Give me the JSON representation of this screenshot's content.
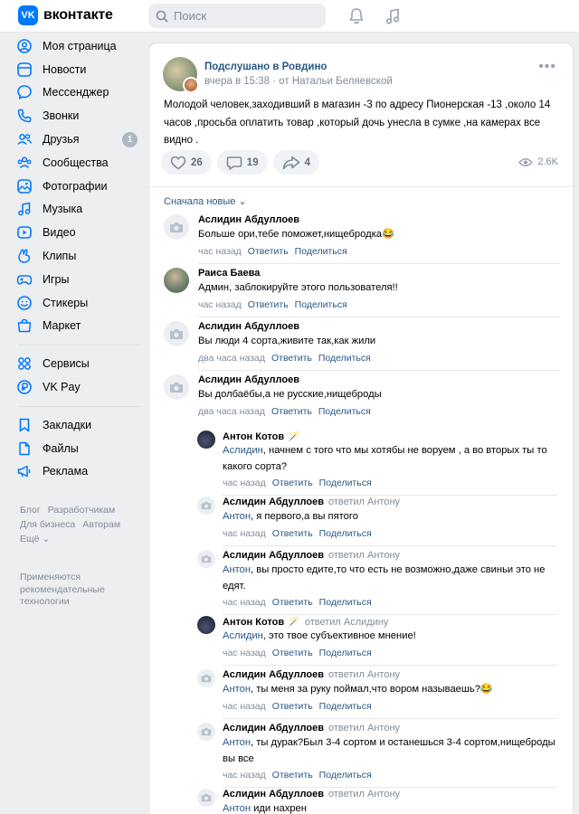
{
  "header": {
    "logo_letter": "VK",
    "logo_text": "вконтакте",
    "search_placeholder": "Поиск",
    "icons": [
      "bell-icon",
      "music-icon"
    ]
  },
  "sidebar": {
    "items": [
      {
        "label": "Моя страница",
        "icon": "profile-icon"
      },
      {
        "label": "Новости",
        "icon": "news-icon"
      },
      {
        "label": "Мессенджер",
        "icon": "messenger-icon"
      },
      {
        "label": "Звонки",
        "icon": "phone-icon"
      },
      {
        "label": "Друзья",
        "icon": "friends-icon",
        "badge": "1"
      },
      {
        "label": "Сообщества",
        "icon": "communities-icon"
      },
      {
        "label": "Фотографии",
        "icon": "photos-icon"
      },
      {
        "label": "Музыка",
        "icon": "music-icon"
      },
      {
        "label": "Видео",
        "icon": "video-icon"
      },
      {
        "label": "Клипы",
        "icon": "clips-icon"
      },
      {
        "label": "Игры",
        "icon": "games-icon"
      },
      {
        "label": "Стикеры",
        "icon": "stickers-icon"
      },
      {
        "label": "Маркет",
        "icon": "market-icon"
      }
    ],
    "items2": [
      {
        "label": "Сервисы",
        "icon": "services-icon"
      },
      {
        "label": "VK Pay",
        "icon": "vkpay-icon"
      }
    ],
    "items3": [
      {
        "label": "Закладки",
        "icon": "bookmarks-icon"
      },
      {
        "label": "Файлы",
        "icon": "files-icon"
      },
      {
        "label": "Реклама",
        "icon": "ads-icon"
      }
    ],
    "footer": {
      "blog": "Блог",
      "developers": "Разработчикам",
      "business": "Для бизнеса",
      "authors": "Авторам",
      "more": "Ещё ⌄",
      "note": "Применяются рекомендательные технологии"
    }
  },
  "post": {
    "author": "Подслушано в Ровдино",
    "meta": "вчера в 15:38 · от Натальи Беляевской",
    "text": "Молодой человек,заходивший в магазин -3 по адресу Пионерская -13 ,около 14 часов ,просьба оплатить товар ,который дочь унесла в сумке ,на камерах все видно .",
    "likes": "26",
    "comments": "19",
    "shares": "4",
    "views": "2.6K",
    "sort_label": "Сначала новые ⌄"
  },
  "comment_labels": {
    "reply": "Ответить",
    "share": "Поделиться"
  },
  "comments": [
    {
      "name": "Аслидин Абдуллоев",
      "text": "Больше ори,тебе поможет,нищебродка😂",
      "time": "час назад"
    },
    {
      "name": "Раиса Баева",
      "text": "Админ, заблокируйте этого пользователя!!",
      "time": "час назад"
    },
    {
      "name": "Аслидин Абдуллоев",
      "text": "Вы люди 4 сорта,живите так,как жили",
      "time": "два часа назад"
    },
    {
      "name": "Аслидин Абдуллоев",
      "text": "Вы долбаёбы,а не русские,нищеброды",
      "time": "два часа назад"
    }
  ],
  "replies": [
    {
      "name": "Антон Котов",
      "wand": "🪄",
      "reply_to": "",
      "addr": "Аслидин",
      "text": ", начнем с того что мы хотябы не воруем , а во вторых ты то какого сорта?",
      "time": "час назад"
    },
    {
      "name": "Аслидин Абдуллоев",
      "wand": "",
      "reply_to": "ответил Антону",
      "addr": "Антон",
      "text": ", я первого,а вы пятого",
      "time": "час назад"
    },
    {
      "name": "Аслидин Абдуллоев",
      "wand": "",
      "reply_to": "ответил Антону",
      "addr": "Антон",
      "text": ", вы просто едите,то что есть не возможно,даже свиньи это не едят.",
      "time": "час назад"
    },
    {
      "name": "Антон Котов",
      "wand": "🪄",
      "reply_to": "ответил Аслидину",
      "addr": "Аслидин",
      "text": ", это твое субъективное мнение!",
      "time": "час назад"
    },
    {
      "name": "Аслидин Абдуллоев",
      "wand": "",
      "reply_to": "ответил Антону",
      "addr": "Антон",
      "text": ", ты меня за руку поймал,что вором называешь?😂",
      "time": "час назад"
    },
    {
      "name": "Аслидин Абдуллоев",
      "wand": "",
      "reply_to": "ответил Антону",
      "addr": "Антон",
      "text": ", ты дурак?Был 3-4 сортом и останешься 3-4 сортом,нищеброды вы все",
      "time": "час назад"
    },
    {
      "name": "Аслидин Абдуллоев",
      "wand": "",
      "reply_to": "ответил Антону",
      "addr": "Антон",
      "text": " иди нахрен",
      "time": ""
    }
  ],
  "colors": {
    "accent": "#0077ff",
    "link": "#2a5885",
    "muted": "#818c99",
    "bg": "#edeef0"
  }
}
